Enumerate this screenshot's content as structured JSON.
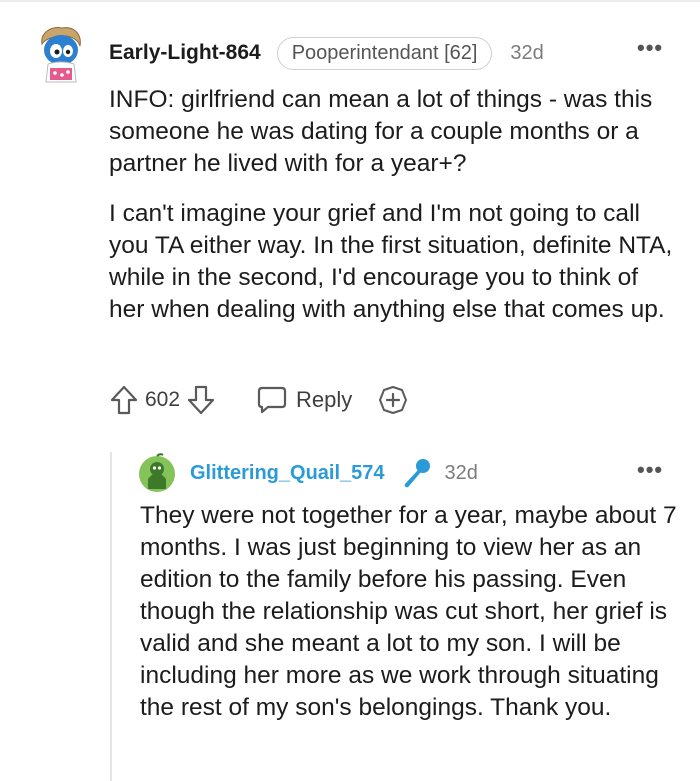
{
  "parent_comment": {
    "username": "Early-Light-864",
    "flair": "Pooperintendant [62]",
    "time": "32d",
    "more": "•••",
    "paragraphs": [
      "INFO: girlfriend can mean a lot of things - was this someone he was dating for a couple months or a partner he lived with for a year+?",
      "I can't imagine your grief and I'm not going to call you TA either way. In the first situation, definite NTA, while in the second, I'd encourage you to think of her when dealing with anything else that comes up."
    ],
    "votes": "602",
    "reply_label": "Reply",
    "icons": [
      "avatar-illustration",
      "upvote-arrow-icon",
      "downvote-arrow-icon",
      "speech-bubble-icon",
      "award-plus-icon",
      "more-horizontal-icon"
    ]
  },
  "reply_comment": {
    "username": "Glittering_Quail_574",
    "time": "32d",
    "more": "•••",
    "text": "They were not together for a year, maybe about 7 months. I was just beginning to view her as an edition to the family before his passing. Even though the relationship was cut short, her grief is valid and she meant a lot to my son. I will be including her more as we work through situating the rest of my son's belongings. Thank you.",
    "icons": [
      "green-avatar-icon",
      "microphone-icon",
      "more-horizontal-icon"
    ]
  },
  "colors": {
    "reply_username": "#2a9bd8",
    "mic_icon": "#2a9bd8",
    "thread_line": "#e5e5e5",
    "muted_text": "#7c7c7c"
  }
}
